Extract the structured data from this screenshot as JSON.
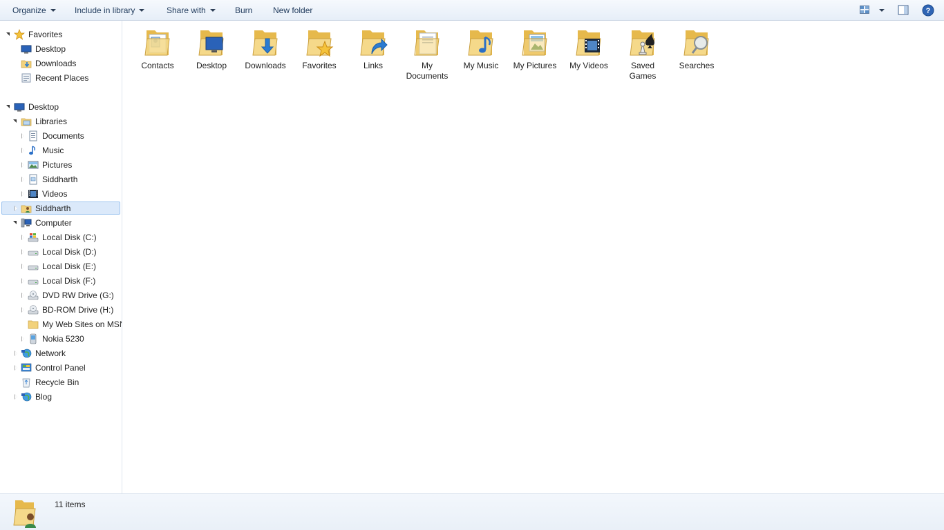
{
  "toolbar": {
    "organize": "Organize",
    "include_in_library": "Include in library",
    "share_with": "Share with",
    "burn": "Burn",
    "new_folder": "New folder",
    "view_icon": "change-view-icon",
    "preview_icon": "preview-pane-icon",
    "help_icon": "help-icon"
  },
  "nav": {
    "favorites": {
      "label": "Favorites",
      "items": [
        "Desktop",
        "Downloads",
        "Recent Places"
      ]
    },
    "desktop": "Desktop",
    "libraries": {
      "label": "Libraries",
      "items": [
        "Documents",
        "Music",
        "Pictures",
        "Siddharth",
        "Videos"
      ]
    },
    "user": "Siddharth",
    "computer": {
      "label": "Computer",
      "items": [
        "Local Disk (C:)",
        "Local Disk (D:)",
        "Local Disk (E:)",
        "Local Disk (F:)",
        "DVD RW Drive (G:)",
        "BD-ROM Drive (H:)",
        "My Web Sites on MSN",
        "Nokia 5230"
      ]
    },
    "network": "Network",
    "control_panel": "Control Panel",
    "recycle_bin": "Recycle Bin",
    "blog": "Blog"
  },
  "content": {
    "folders": [
      {
        "line1": "Contacts",
        "line2": ""
      },
      {
        "line1": "Desktop",
        "line2": ""
      },
      {
        "line1": "Downloads",
        "line2": ""
      },
      {
        "line1": "Favorites",
        "line2": ""
      },
      {
        "line1": "Links",
        "line2": ""
      },
      {
        "line1": "My",
        "line2": "Documents"
      },
      {
        "line1": "My Music",
        "line2": ""
      },
      {
        "line1": "My Pictures",
        "line2": ""
      },
      {
        "line1": "My Videos",
        "line2": ""
      },
      {
        "line1": "Saved",
        "line2": "Games"
      },
      {
        "line1": "Searches",
        "line2": ""
      }
    ]
  },
  "status": {
    "count": "11 items"
  },
  "colors": {
    "folder": "#f2d27c",
    "folder_dark": "#d7a93c",
    "selection": "#dbe9fa",
    "toolbar_text": "#1e395b"
  }
}
